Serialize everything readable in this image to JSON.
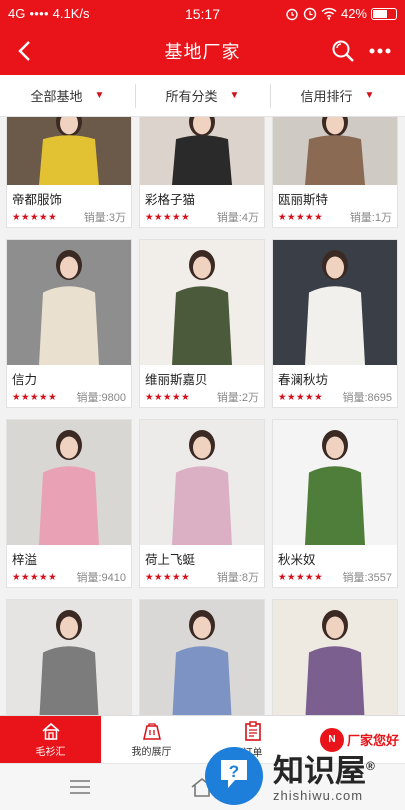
{
  "status_bar": {
    "network": "4G",
    "signal": "●●●●",
    "speed": "4.1K/s",
    "time": "15:17",
    "battery": "42%"
  },
  "header": {
    "title": "基地厂家"
  },
  "filters": [
    {
      "label": "全部基地"
    },
    {
      "label": "所有分类"
    },
    {
      "label": "信用排行"
    }
  ],
  "rating_stars": "★★★★★",
  "products": [
    {
      "name": "帝都服饰",
      "sales": "销量:3万",
      "colors": {
        "bg": "#6b5a4a",
        "top": "#e2c232"
      }
    },
    {
      "name": "彩格子猫",
      "sales": "销量:4万",
      "colors": {
        "bg": "#dcd4cc",
        "top": "#2a2a2a"
      }
    },
    {
      "name": "瓯丽斯特",
      "sales": "销量:1万",
      "colors": {
        "bg": "#cfcac4",
        "top": "#8a6a52"
      }
    },
    {
      "name": "信力",
      "sales": "销量:9800",
      "colors": {
        "bg": "#8e8e8e",
        "top": "#eae0cf"
      }
    },
    {
      "name": "维丽斯嘉贝",
      "sales": "销量:2万",
      "colors": {
        "bg": "#f1ede8",
        "top": "#4a5a3a"
      }
    },
    {
      "name": "春澜秋坊",
      "sales": "销量:8695",
      "colors": {
        "bg": "#3a3f47",
        "top": "#f2f0ec"
      }
    },
    {
      "name": "梓溢",
      "sales": "销量:9410",
      "colors": {
        "bg": "#d9d7d4",
        "top": "#e9a2b5"
      }
    },
    {
      "name": "荷上飞蜓",
      "sales": "销量:8万",
      "colors": {
        "bg": "#ecebea",
        "top": "#dcb0c4"
      }
    },
    {
      "name": "秋米奴",
      "sales": "销量:3557",
      "colors": {
        "bg": "#f4f4f4",
        "top": "#4f7d3a"
      }
    },
    {
      "name": "",
      "sales": "",
      "colors": {
        "bg": "#e6e4e2",
        "top": "#7c7c7c"
      }
    },
    {
      "name": "",
      "sales": "",
      "colors": {
        "bg": "#dad8d6",
        "top": "#7c93c3"
      }
    },
    {
      "name": "",
      "sales": "",
      "colors": {
        "bg": "#eeeae2",
        "top": "#7a5f8f"
      }
    }
  ],
  "tabs": [
    {
      "label": "毛衫汇",
      "active": true
    },
    {
      "label": "我的展厅",
      "active": false
    },
    {
      "label": "订单",
      "active": false
    }
  ],
  "brand": {
    "logo": "N",
    "text": "厂家您好"
  },
  "watermark": {
    "big": "知识屋",
    "small": "zhishiwu.com",
    "registered": "®"
  },
  "accent_color": "#e8141a"
}
